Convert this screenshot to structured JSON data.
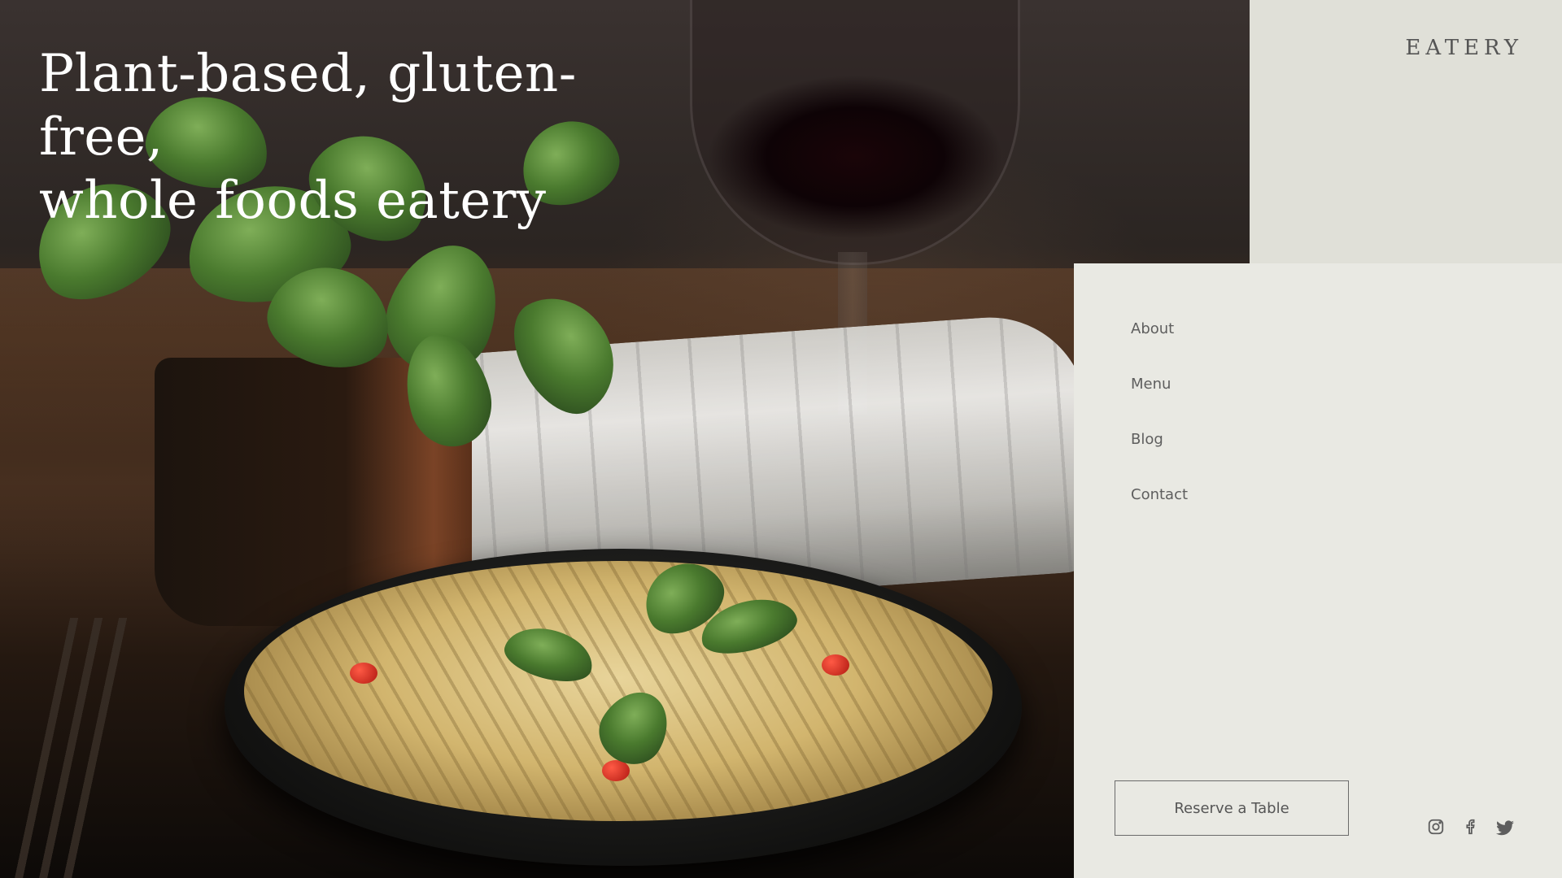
{
  "hero": {
    "headline_line1": "Plant-based, gluten-free,",
    "headline_line2": "whole foods eatery"
  },
  "brand": {
    "name": "EATERY"
  },
  "nav": {
    "items": [
      {
        "label": "About"
      },
      {
        "label": "Menu"
      },
      {
        "label": "Blog"
      },
      {
        "label": "Contact"
      }
    ]
  },
  "cta": {
    "reserve_label": "Reserve a Table"
  },
  "social": {
    "icons": [
      "instagram-icon",
      "facebook-icon",
      "twitter-icon"
    ]
  },
  "colors": {
    "brand_panel": "#e0e0d8",
    "menu_panel": "#e9e9e3",
    "text_muted": "#5e5e5e",
    "headline": "#ffffff"
  }
}
